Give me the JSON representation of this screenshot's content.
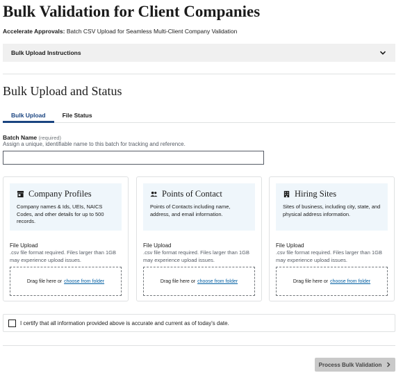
{
  "page": {
    "title": "Bulk Validation for Client Companies",
    "subtitle_lead": "Accelerate Approvals:",
    "subtitle_rest": " Batch CSV Upload for Seamless Multi-Client Company Validation"
  },
  "accordion": {
    "label": "Bulk Upload Instructions",
    "icon": "chevron-down-icon"
  },
  "section": {
    "title": "Bulk Upload and Status"
  },
  "tabs": [
    {
      "label": "Bulk Upload",
      "active": true
    },
    {
      "label": "File Status",
      "active": false
    }
  ],
  "batch": {
    "label": "Batch Name",
    "required": "(required)",
    "hint": "Assign a unique, identifiable name to this batch for tracking and reference.",
    "value": "",
    "placeholder": ""
  },
  "cards": [
    {
      "icon": "building-store-icon",
      "title": "Company Profiles",
      "description": "Company names & Ids, UEIs, NAICS Codes, and other details for up to 500 records.",
      "file_label": "File Upload",
      "file_hint": ".csv file format required. Files larger than 1GB may experience upload issues.",
      "drop_text": "Drag file here or",
      "drop_link": "choose from folder"
    },
    {
      "icon": "people-icon",
      "title": "Points of Contact",
      "description": "Points of Contacts including name, address, and email information.",
      "file_label": "File Upload",
      "file_hint": ".csv file format required. Files larger than 1GB may experience upload issues.",
      "drop_text": "Drag file here or",
      "drop_link": "choose from folder"
    },
    {
      "icon": "office-building-icon",
      "title": "Hiring Sites",
      "description": "Sites of business, including city, state, and physical address information.",
      "file_label": "File Upload",
      "file_hint": ".csv file format required. Files larger than 1GB may experience upload issues.",
      "drop_text": "Drag file here or",
      "drop_link": "choose from folder"
    }
  ],
  "certify": {
    "label": "I certify that all information provided above is accurate and current as of today's date.",
    "checked": false
  },
  "submit": {
    "label": "Process Bulk Validation",
    "icon": "chevron-right-icon"
  },
  "colors": {
    "accent": "#1a4480",
    "link": "#005ea2",
    "card_head_bg": "#eff6fb",
    "button_disabled": "#c9c9c9"
  }
}
